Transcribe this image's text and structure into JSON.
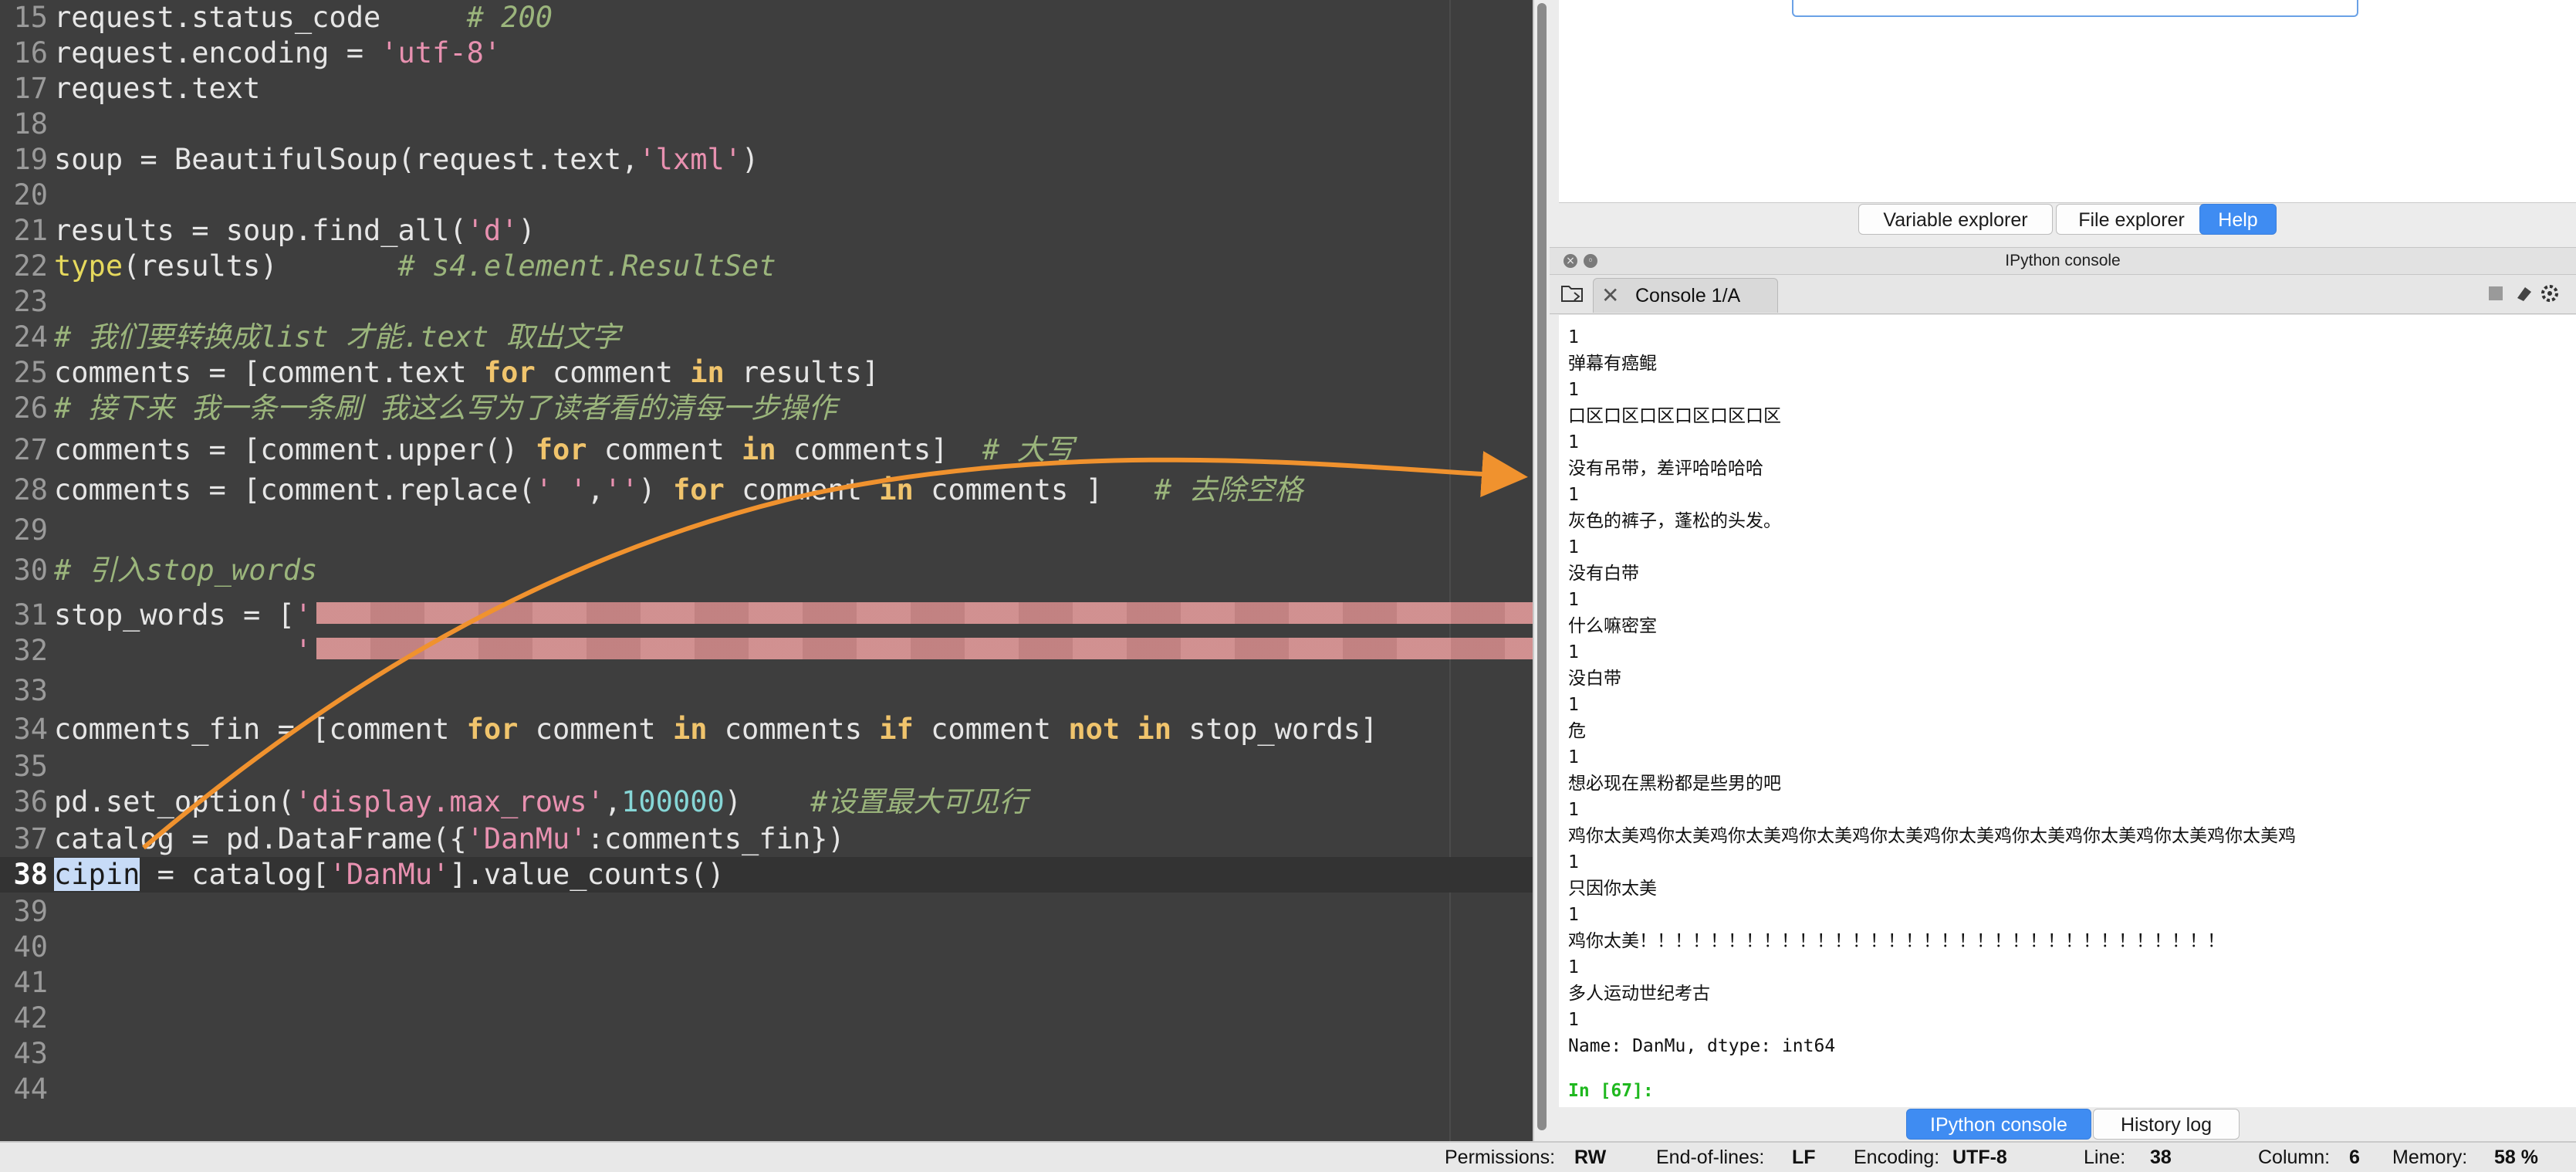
{
  "editor": {
    "lines": [
      {
        "n": "15",
        "html": "request.status_code     <span class=\"t-com\"># 200</span>"
      },
      {
        "n": "16",
        "html": "request.encoding = <span class=\"t-str\">'utf-8'</span>"
      },
      {
        "n": "17",
        "html": "request.text"
      },
      {
        "n": "18",
        "html": ""
      },
      {
        "n": "19",
        "html": "soup = BeautifulSoup(request.text,<span class=\"t-str\">'lxml'</span>)"
      },
      {
        "n": "20",
        "html": ""
      },
      {
        "n": "21",
        "html": "results = soup.find_all(<span class=\"t-str\">'d'</span>)"
      },
      {
        "n": "22",
        "html": "<span class=\"t-fn\">type</span>(results)       <span class=\"t-com\"># s4.element.ResultSet</span>"
      },
      {
        "n": "23",
        "html": ""
      },
      {
        "n": "24",
        "html": "<span class=\"t-com\"># 我们要转换成list 才能.text 取出文字</span>"
      },
      {
        "n": "25",
        "html": "comments = [comment.text <span class=\"t-kw\">for</span> comment <span class=\"t-kw\">in</span> results]"
      },
      {
        "n": "26",
        "html": "<span class=\"t-com\"># 接下来 我一条一条刷 我这么写为了读者看的清每一步操作</span>"
      },
      {
        "n": "27",
        "html": "comments = [comment.upper() <span class=\"t-kw\">for</span> comment <span class=\"t-kw\">in</span> comments]  <span class=\"t-com\"># 大写</span>"
      },
      {
        "n": "28",
        "html": "comments = [comment.replace(<span class=\"t-str\">' '</span>,<span class=\"t-str\">''</span>) <span class=\"t-kw\">for</span> comment <span class=\"t-kw\">in</span> comments ]   <span class=\"t-com\"># 去除空格</span>"
      },
      {
        "n": "29",
        "html": ""
      },
      {
        "n": "30",
        "html": "<span class=\"t-com\"># 引入stop_words</span>"
      },
      {
        "n": "31",
        "html": "stop_words = [<span class=\"t-str\">'</span>"
      },
      {
        "n": "32",
        "html": "              <span class=\"t-str\">'</span>"
      },
      {
        "n": "33",
        "html": ""
      },
      {
        "n": "34",
        "html": "comments_fin = [comment <span class=\"t-kw\">for</span> comment <span class=\"t-kw\">in</span> comments <span class=\"t-kw\">if</span> comment <span class=\"t-kw\">not in</span> stop_words]"
      },
      {
        "n": "35",
        "html": ""
      },
      {
        "n": "36",
        "html": "pd.set_option(<span class=\"t-str\">'display.max_rows'</span>,<span class=\"t-num\">100000</span>)    <span class=\"t-com\">#设置最大可见行</span>"
      },
      {
        "n": "37",
        "html": "catalog = pd.DataFrame({<span class=\"t-str\">'DanMu'</span>:comments_fin})"
      },
      {
        "n": "38",
        "html": "<span class=\"sel\">cipin</span> = catalog[<span class=\"t-str\">'DanMu'</span>].value_counts()",
        "current": true
      },
      {
        "n": "39",
        "html": ""
      },
      {
        "n": "40",
        "html": ""
      },
      {
        "n": "41",
        "html": ""
      },
      {
        "n": "42",
        "html": ""
      },
      {
        "n": "43",
        "html": ""
      },
      {
        "n": "44",
        "html": ""
      }
    ]
  },
  "help_tabs": {
    "variable_explorer": "Variable explorer",
    "file_explorer": "File explorer",
    "help": "Help"
  },
  "ipython": {
    "title": "IPython console",
    "console_tab": "Console 1/A"
  },
  "console_output": [
    "1",
    "弹幕有癌鲲",
    "1",
    "口区口区口区口区口区口区",
    "1",
    "没有吊带，差评哈哈哈哈",
    "1",
    "灰色的裤子，蓬松的头发。",
    "1",
    "没有白带",
    "1",
    "什么嘛密室",
    "1",
    "没白带",
    "1",
    "危",
    "1",
    "想必现在黑粉都是些男的吧",
    "1",
    "鸡你太美鸡你太美鸡你太美鸡你太美鸡你太美鸡你太美鸡你太美鸡你太美鸡你太美鸡你太美鸡",
    "1",
    "只因你太美",
    "1",
    "鸡你太美！！！！！！！！！！！！！！！！！！！！！！！！！！！！！！！！！",
    "1",
    "多人运动世纪考古",
    "1",
    "Name: DanMu, dtype: int64"
  ],
  "prompt": "In [67]:",
  "console_tabs": {
    "ipython": "IPython console",
    "history": "History log"
  },
  "status": {
    "permissions_label": "Permissions:",
    "permissions": "RW",
    "eol_label": "End-of-lines:",
    "eol": "LF",
    "encoding_label": "Encoding:",
    "encoding": "UTF-8",
    "line_label": "Line:",
    "line": "38",
    "column_label": "Column:",
    "column": "6",
    "memory_label": "Memory:",
    "memory": "58 %"
  }
}
